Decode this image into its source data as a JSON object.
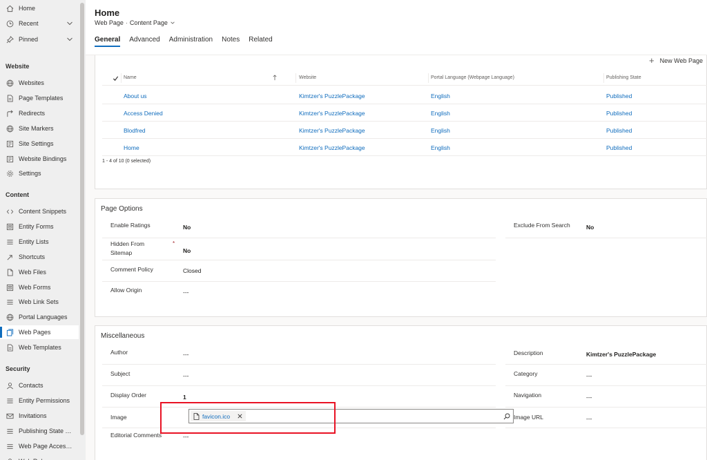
{
  "sidebar": {
    "top": [
      {
        "label": "Home",
        "icon": "home-icon"
      },
      {
        "label": "Recent",
        "icon": "clock-icon",
        "expand": true
      },
      {
        "label": "Pinned",
        "icon": "pin-icon",
        "expand": true
      }
    ],
    "groups": [
      {
        "title": "Website",
        "items": [
          {
            "label": "Websites",
            "icon": "globe-icon"
          },
          {
            "label": "Page Templates",
            "icon": "document-icon"
          },
          {
            "label": "Redirects",
            "icon": "redirect-icon"
          },
          {
            "label": "Site Markers",
            "icon": "globe-icon"
          },
          {
            "label": "Site Settings",
            "icon": "settings-list-icon"
          },
          {
            "label": "Website Bindings",
            "icon": "settings-list-icon"
          },
          {
            "label": "Settings",
            "icon": "gear-icon"
          }
        ]
      },
      {
        "title": "Content",
        "items": [
          {
            "label": "Content Snippets",
            "icon": "snippet-icon"
          },
          {
            "label": "Entity Forms",
            "icon": "form-icon"
          },
          {
            "label": "Entity Lists",
            "icon": "list-icon"
          },
          {
            "label": "Shortcuts",
            "icon": "shortcut-icon"
          },
          {
            "label": "Web Files",
            "icon": "file-icon"
          },
          {
            "label": "Web Forms",
            "icon": "form-icon"
          },
          {
            "label": "Web Link Sets",
            "icon": "list-icon"
          },
          {
            "label": "Portal Languages",
            "icon": "globe-icon"
          },
          {
            "label": "Web Pages",
            "icon": "pages-icon",
            "active": true
          },
          {
            "label": "Web Templates",
            "icon": "document-icon"
          }
        ]
      },
      {
        "title": "Security",
        "items": [
          {
            "label": "Contacts",
            "icon": "person-icon"
          },
          {
            "label": "Entity Permissions",
            "icon": "list-icon"
          },
          {
            "label": "Invitations",
            "icon": "invitation-icon"
          },
          {
            "label": "Publishing State Tr...",
            "icon": "list-icon"
          },
          {
            "label": "Web Page Access ...",
            "icon": "list-icon"
          },
          {
            "label": "Web Roles",
            "icon": "person-icon"
          }
        ]
      }
    ]
  },
  "header": {
    "title": "Home",
    "entity": "Web Page",
    "form": "Content Page",
    "tabs": [
      "General",
      "Advanced",
      "Administration",
      "Notes",
      "Related"
    ]
  },
  "subgrid": {
    "new_label": "New Web Page",
    "columns": [
      "Name",
      "Website",
      "Portal Language (Webpage Language)",
      "Publishing State"
    ],
    "rows": [
      [
        "About us",
        "Kimtzer's PuzzlePackage",
        "English",
        "Published"
      ],
      [
        "Access Denied",
        "Kimtzer's PuzzlePackage",
        "English",
        "Published"
      ],
      [
        "Blodfred",
        "Kimtzer's PuzzlePackage",
        "English",
        "Published"
      ],
      [
        "Home",
        "Kimtzer's PuzzlePackage",
        "English",
        "Published"
      ]
    ],
    "footer": "1 - 4 of 10 (0 selected)"
  },
  "page_options": {
    "title": "Page Options",
    "enable_ratings": {
      "label": "Enable Ratings",
      "value": "No"
    },
    "hidden_from_sitemap": {
      "label": "Hidden From Sitemap",
      "value": "No"
    },
    "comment_policy": {
      "label": "Comment Policy",
      "value": "Closed"
    },
    "allow_origin": {
      "label": "Allow Origin",
      "value": "---"
    },
    "exclude_from_search": {
      "label": "Exclude From Search",
      "value": "No"
    }
  },
  "misc": {
    "title": "Miscellaneous",
    "author": {
      "label": "Author",
      "value": "---"
    },
    "subject": {
      "label": "Subject",
      "value": "---"
    },
    "display_order": {
      "label": "Display Order",
      "value": "1"
    },
    "image": {
      "label": "Image",
      "value": "favicon.ico"
    },
    "editorial_comments": {
      "label": "Editorial Comments",
      "value": "---"
    },
    "description": {
      "label": "Description",
      "value": "Kimtzer's PuzzlePackage"
    },
    "category": {
      "label": "Category",
      "value": "---"
    },
    "navigation": {
      "label": "Navigation",
      "value": "---"
    },
    "image_url": {
      "label": "Image URL",
      "value": "---"
    }
  },
  "colors": {
    "accent": "#0f6cbd",
    "highlight": "#e81123"
  }
}
